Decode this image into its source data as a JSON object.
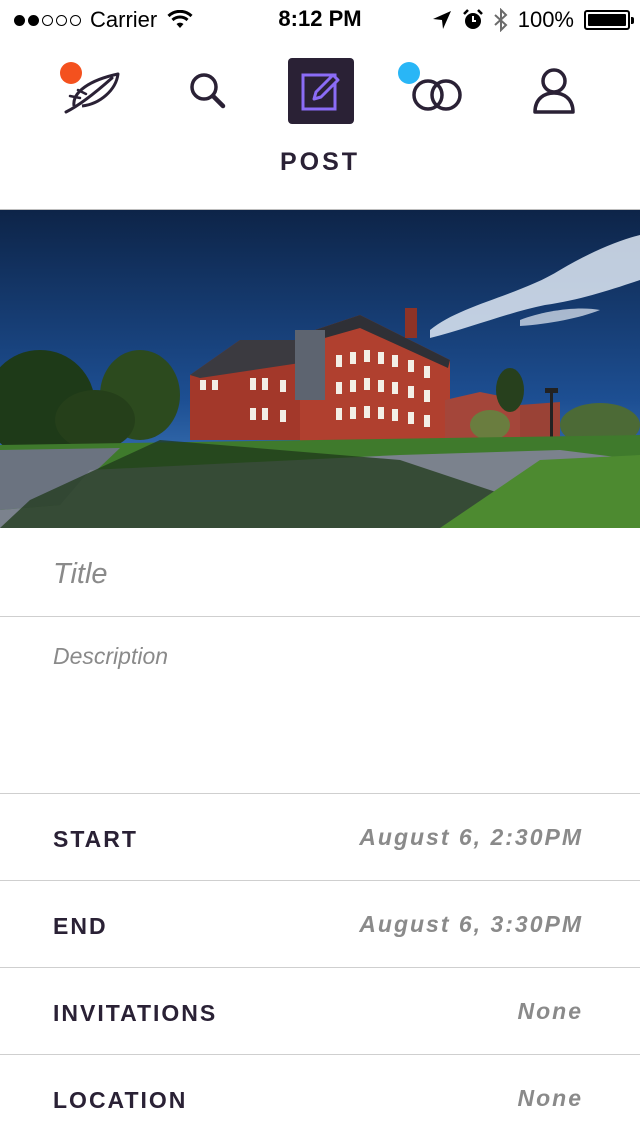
{
  "status_bar": {
    "carrier": "Carrier",
    "time": "8:12 PM",
    "battery": "100%"
  },
  "nav": {
    "title": "POST",
    "icons": [
      "feather-icon",
      "search-icon",
      "compose-icon",
      "circles-icon",
      "profile-icon"
    ],
    "badge_colors": {
      "feather": "#f4511e",
      "circles": "#29b6f6"
    },
    "active_color": "#2a2135",
    "accent_color": "#8b6cf6"
  },
  "form": {
    "title_placeholder": "Title",
    "description_placeholder": "Description",
    "rows": [
      {
        "label": "START",
        "value": "August 6, 2:30PM"
      },
      {
        "label": "END",
        "value": "August 6, 3:30PM"
      },
      {
        "label": "INVITATIONS",
        "value": "None"
      },
      {
        "label": "LOCATION",
        "value": "None"
      }
    ]
  }
}
